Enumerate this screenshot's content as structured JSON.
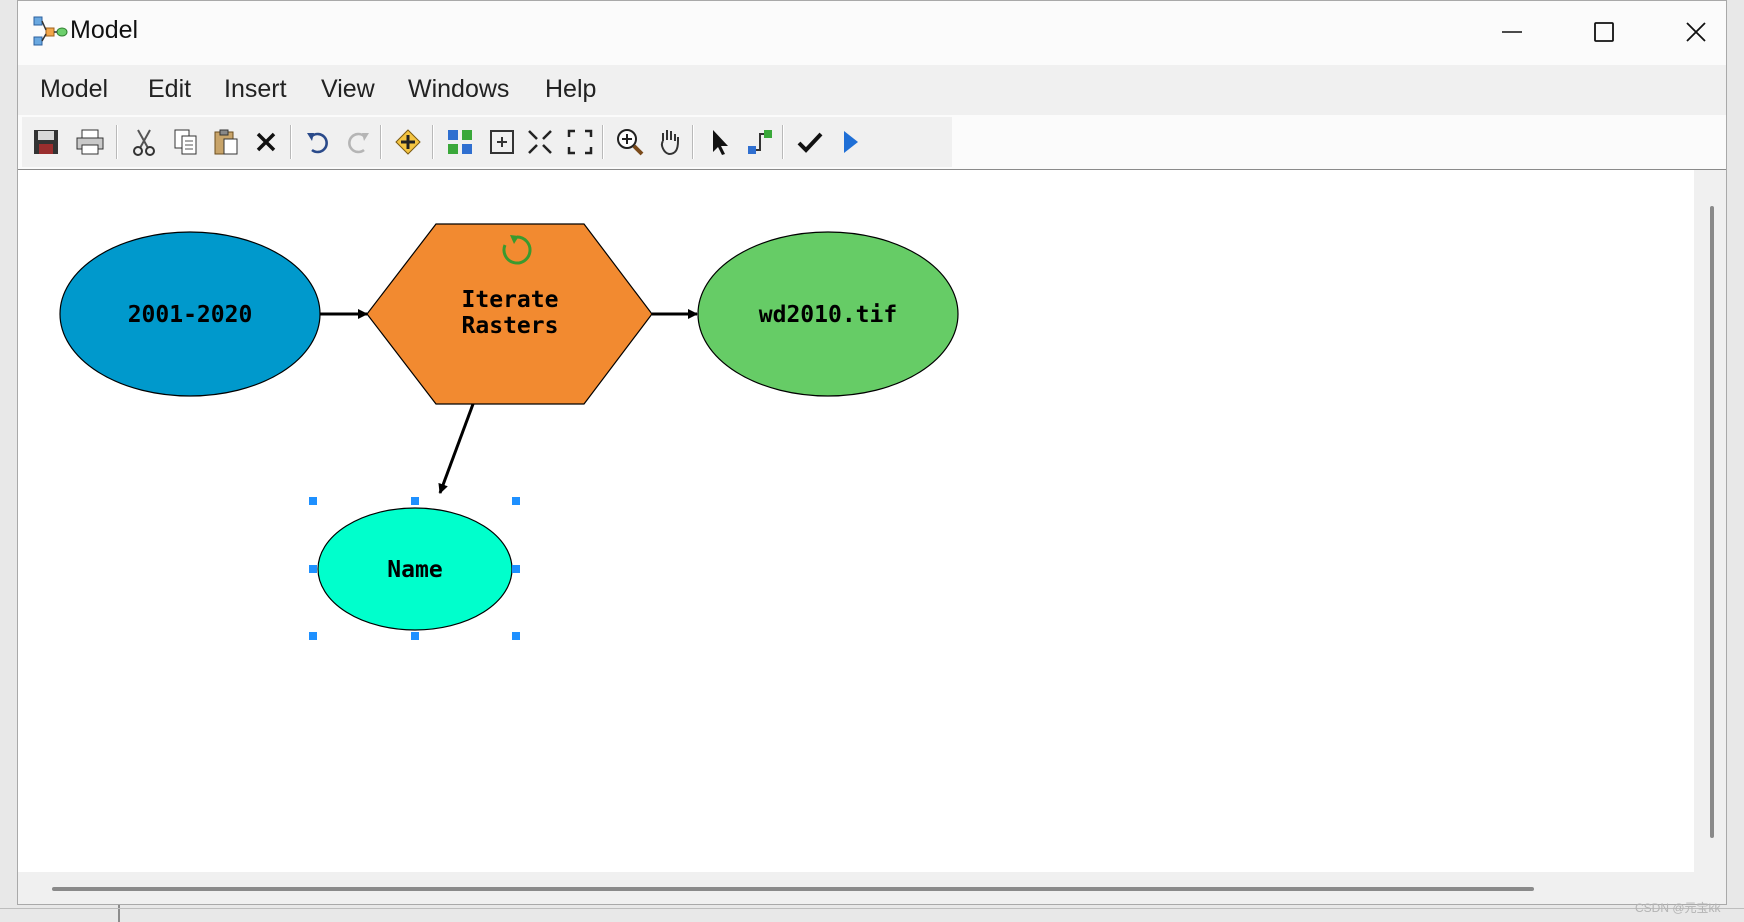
{
  "window": {
    "title": "Model"
  },
  "menu": [
    "Model",
    "Edit",
    "Insert",
    "View",
    "Windows",
    "Help"
  ],
  "toolbar": [
    {
      "icon": "save-icon"
    },
    {
      "icon": "print-icon"
    },
    {
      "icon": "cut-icon"
    },
    {
      "icon": "copy-icon"
    },
    {
      "icon": "paste-icon"
    },
    {
      "icon": "delete-icon"
    },
    {
      "icon": "undo-icon"
    },
    {
      "icon": "redo-icon"
    },
    {
      "icon": "add-data-icon"
    },
    {
      "icon": "auto-layout-icon"
    },
    {
      "icon": "full-extent-icon"
    },
    {
      "icon": "fixed-zoom-in-icon"
    },
    {
      "icon": "fixed-zoom-out-icon"
    },
    {
      "icon": "zoom-in-icon"
    },
    {
      "icon": "pan-icon"
    },
    {
      "icon": "select-icon"
    },
    {
      "icon": "add-connection-icon"
    },
    {
      "icon": "validate-icon"
    },
    {
      "icon": "run-icon"
    }
  ],
  "diagram": {
    "nodes": {
      "input": {
        "label": "2001-2020",
        "color": "#0099cc"
      },
      "iterator": {
        "label_line1": "Iterate",
        "label_line2": "Rasters",
        "color": "#f28a30",
        "icon": "iterate-icon"
      },
      "output": {
        "label": "wd2010.tif",
        "color": "#66cc66"
      },
      "name": {
        "label": "Name",
        "color": "#00ffcc",
        "selected": true
      }
    },
    "connections": [
      "input-to-iterator",
      "iterator-to-output",
      "iterator-to-name"
    ]
  },
  "watermark": "CSDN @元宝kk"
}
